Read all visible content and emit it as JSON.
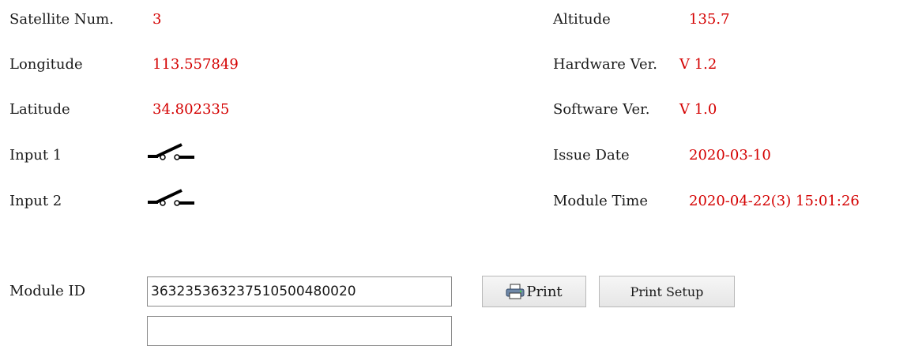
{
  "left_column": {
    "satellite_label": "Satellite Num.",
    "satellite_value": "3",
    "longitude_label": "Longitude",
    "longitude_value": "113.557849",
    "latitude_label": "Latitude",
    "latitude_value": "34.802335",
    "input1_label": "Input 1",
    "input1_icon": "switch-open-icon",
    "input2_label": "Input 2",
    "input2_icon": "switch-open-icon"
  },
  "right_column": {
    "altitude_label": "Altitude",
    "altitude_value": "135.7",
    "hardware_label": "Hardware Ver.",
    "hardware_value": "V 1.2",
    "software_label": "Software Ver.",
    "software_value": "V 1.0",
    "issue_date_label": "Issue Date",
    "issue_date_value": "2020-03-10",
    "module_time_label": "Module Time",
    "module_time_value": "2020-04-22(3) 15:01:26"
  },
  "module": {
    "id_label": "Module ID",
    "id_value": "36323536323751050048002​0",
    "second_field_value": ""
  },
  "buttons": {
    "print_label": "Print",
    "print_icon": "printer-icon",
    "print_setup_label": "Print Setup"
  },
  "colors": {
    "value": "#d40000",
    "label": "#1a1a1a"
  }
}
